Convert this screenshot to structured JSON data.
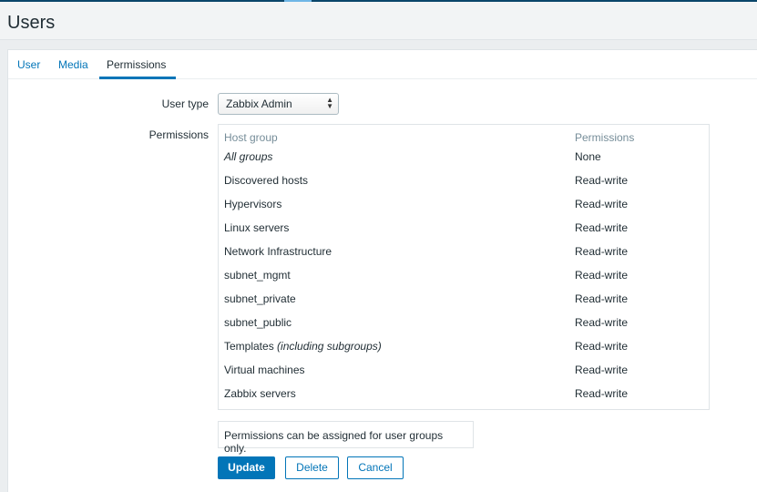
{
  "header": {
    "title": "Users"
  },
  "tabs": [
    {
      "label": "User",
      "active": false
    },
    {
      "label": "Media",
      "active": false
    },
    {
      "label": "Permissions",
      "active": true
    }
  ],
  "form": {
    "user_type_label": "User type",
    "user_type_value": "Zabbix Admin",
    "permissions_label": "Permissions"
  },
  "permissions_table": {
    "columns": [
      "Host group",
      "Permissions"
    ],
    "rows": [
      {
        "group": "All groups",
        "group_suffix": "",
        "permission": "None"
      },
      {
        "group": "Discovered hosts",
        "group_suffix": "",
        "permission": "Read-write"
      },
      {
        "group": "Hypervisors",
        "group_suffix": "",
        "permission": "Read-write"
      },
      {
        "group": "Linux servers",
        "group_suffix": "",
        "permission": "Read-write"
      },
      {
        "group": "Network Infrastructure",
        "group_suffix": "",
        "permission": "Read-write"
      },
      {
        "group": "subnet_mgmt",
        "group_suffix": "",
        "permission": "Read-write"
      },
      {
        "group": "subnet_private",
        "group_suffix": "",
        "permission": "Read-write"
      },
      {
        "group": "subnet_public",
        "group_suffix": "",
        "permission": "Read-write"
      },
      {
        "group": "Templates",
        "group_suffix": "(including subgroups)",
        "permission": "Read-write"
      },
      {
        "group": "Virtual machines",
        "group_suffix": "",
        "permission": "Read-write"
      },
      {
        "group": "Zabbix servers",
        "group_suffix": "",
        "permission": "Read-write"
      }
    ]
  },
  "hint": "Permissions can be assigned for user groups only.",
  "buttons": {
    "update": "Update",
    "delete": "Delete",
    "cancel": "Cancel"
  },
  "colors": {
    "accent": "#0275b8",
    "header_text": "#768d99"
  }
}
